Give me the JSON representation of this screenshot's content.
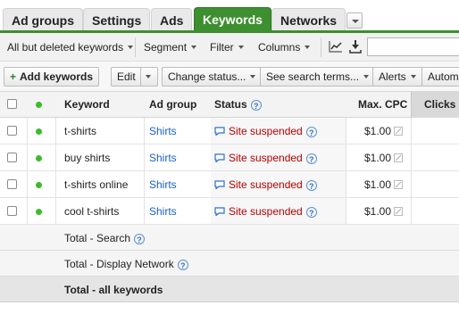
{
  "tabs": [
    "Ad groups",
    "Settings",
    "Ads",
    "Keywords",
    "Networks"
  ],
  "active_tab": "Keywords",
  "filters": {
    "view": "All but deleted keywords",
    "segment": "Segment",
    "filter": "Filter",
    "columns": "Columns",
    "search_placeholder": ""
  },
  "actions": {
    "add": "Add keywords",
    "edit": "Edit",
    "change_status": "Change status...",
    "see_search_terms": "See search terms...",
    "alerts": "Alerts",
    "automate": "Automa"
  },
  "columns": {
    "keyword": "Keyword",
    "ad_group": "Ad group",
    "status": "Status",
    "max_cpc": "Max. CPC",
    "clicks": "Clicks"
  },
  "rows": [
    {
      "keyword": "t-shirts",
      "ad_group": "Shirts",
      "status": "Site suspended",
      "max_cpc": "$1.00"
    },
    {
      "keyword": "buy shirts",
      "ad_group": "Shirts",
      "status": "Site suspended",
      "max_cpc": "$1.00"
    },
    {
      "keyword": "t-shirts online",
      "ad_group": "Shirts",
      "status": "Site suspended",
      "max_cpc": "$1.00"
    },
    {
      "keyword": "cool t-shirts",
      "ad_group": "Shirts",
      "status": "Site suspended",
      "max_cpc": "$1.00"
    }
  ],
  "totals": {
    "search": "Total - Search",
    "display": "Total - Display Network",
    "all": "Total - all keywords"
  },
  "colors": {
    "active_tab": "#3d8f2f",
    "status_red": "#b30000",
    "link_blue": "#1a5fc4",
    "enabled_dot": "#3dbb2a"
  }
}
